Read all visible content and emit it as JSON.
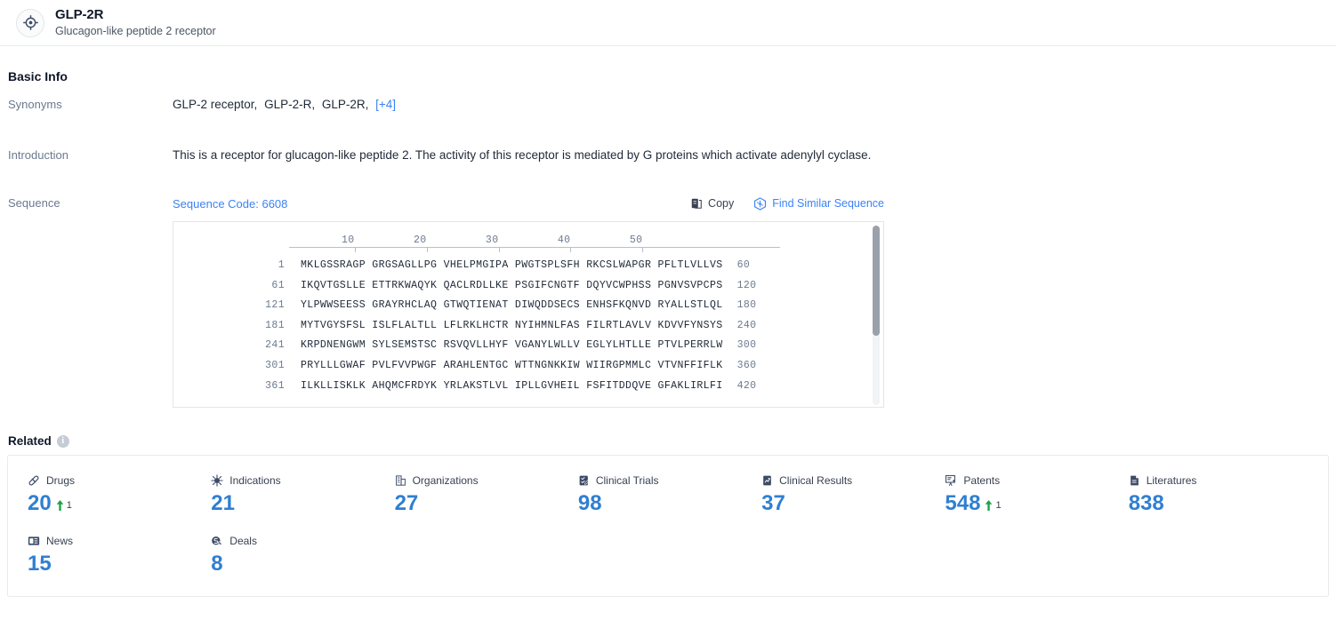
{
  "header": {
    "icon": "target-icon",
    "title": "GLP-2R",
    "subtitle": "Glucagon-like peptide 2 receptor"
  },
  "basic_info": {
    "section_title": "Basic Info",
    "synonyms": {
      "label": "Synonyms",
      "items": [
        "GLP-2 receptor,",
        "GLP-2-R,",
        "GLP-2R,"
      ],
      "more": "[+4]"
    },
    "introduction": {
      "label": "Introduction",
      "text": "This is a receptor for glucagon-like peptide 2. The activity of this receptor is mediated by G proteins which activate adenylyl cyclase."
    },
    "sequence": {
      "label": "Sequence",
      "code": "Sequence Code: 6608",
      "copy_label": "Copy",
      "find_similar_label": "Find Similar Sequence",
      "ruler_ticks": [
        10,
        20,
        30,
        40,
        50
      ],
      "rows": [
        {
          "start": "1",
          "residues": "MKLGSSRAGP GRGSAGLLPG VHELPMGIPA PWGTSPLSFH RKCSLWAPGR PFLTLVLLVS",
          "end": "60"
        },
        {
          "start": "61",
          "residues": "IKQVTGSLLE ETTRKWAQYK QACLRDLLKE PSGIFCNGTF DQYVCWPHSS PGNVSVPCPS",
          "end": "120"
        },
        {
          "start": "121",
          "residues": "YLPWWSEESS GRAYRHCLAQ GTWQTIENAT DIWQDDSECS ENHSFKQNVD RYALLSTLQL",
          "end": "180"
        },
        {
          "start": "181",
          "residues": "MYTVGYSFSL ISLFLALTLL LFLRKLHCTR NYIHMNLFAS FILRTLAVLV KDVVFYNSYS",
          "end": "240"
        },
        {
          "start": "241",
          "residues": "KRPDNENGWM SYLSEMSTSC RSVQVLLHYF VGANYLWLLV EGLYLHTLLE PTVLPERRLW",
          "end": "300"
        },
        {
          "start": "301",
          "residues": "PRYLLLGWAF PVLFVVPWGF ARAHLENTGC WTTNGNKKIW WIIRGPMMLC VTVNFFIFLK",
          "end": "360"
        },
        {
          "start": "361",
          "residues": "ILKLLISKLK AHQMCFRDYK YRLAKSTLVL IPLLGVHEIL FSFITDDQVE GFAKLIRLFI",
          "end": "420"
        }
      ]
    }
  },
  "related": {
    "title": "Related",
    "info_glyph": "i",
    "cards": [
      {
        "icon": "pill-icon",
        "label": "Drugs",
        "value": "20",
        "delta": "1"
      },
      {
        "icon": "virus-icon",
        "label": "Indications",
        "value": "21",
        "delta": ""
      },
      {
        "icon": "organization-icon",
        "label": "Organizations",
        "value": "27",
        "delta": ""
      },
      {
        "icon": "clinical-trial-icon",
        "label": "Clinical Trials",
        "value": "98",
        "delta": ""
      },
      {
        "icon": "clinical-result-icon",
        "label": "Clinical Results",
        "value": "37",
        "delta": ""
      },
      {
        "icon": "patent-icon",
        "label": "Patents",
        "value": "548",
        "delta": "1"
      },
      {
        "icon": "literature-icon",
        "label": "Literatures",
        "value": "838",
        "delta": ""
      },
      {
        "icon": "news-icon",
        "label": "News",
        "value": "15",
        "delta": ""
      },
      {
        "icon": "deal-icon",
        "label": "Deals",
        "value": "8",
        "delta": ""
      }
    ]
  },
  "colors": {
    "accent_blue": "#2f7fd1",
    "link_blue": "#3b82f6",
    "delta_green": "#22a14a",
    "icon_navy": "#3c4a66",
    "label_gray": "#6b7a8f"
  }
}
